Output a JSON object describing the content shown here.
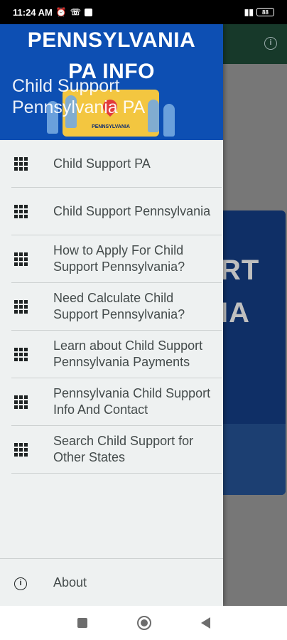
{
  "status_bar": {
    "time": "11:24 AM",
    "battery": "88"
  },
  "drawer": {
    "header": {
      "title_line1": "PENNSYLVANIA",
      "title_line2": "PA INFO",
      "subtitle": "Child Support Pennsylvania PA",
      "map_label": "PENNSYLVANIA"
    },
    "menu_items": [
      {
        "label": "Child Support PA",
        "icon": "grid-icon"
      },
      {
        "label": "Child Support Pennsylvania",
        "icon": "grid-icon"
      },
      {
        "label": "How to Apply For Child Support Pennsylvania?",
        "icon": "grid-icon"
      },
      {
        "label": "Need Calculate Child Support Pennsylvania?",
        "icon": "grid-icon"
      },
      {
        "label": "Learn about Child Support Pennsylvania Payments",
        "icon": "grid-icon"
      },
      {
        "label": "Pennsylvania Child Support Info And Contact",
        "icon": "grid-icon"
      },
      {
        "label": "Search Child Support for Other States",
        "icon": "grid-icon"
      }
    ],
    "about": {
      "label": "About",
      "icon": "info-icon"
    }
  },
  "background": {
    "banner_line1": "RT",
    "banner_line2": "IA"
  },
  "colors": {
    "header_blue": "#0d4fb3",
    "drawer_bg": "#eef1f1",
    "appbar_dim": "#17392a"
  }
}
